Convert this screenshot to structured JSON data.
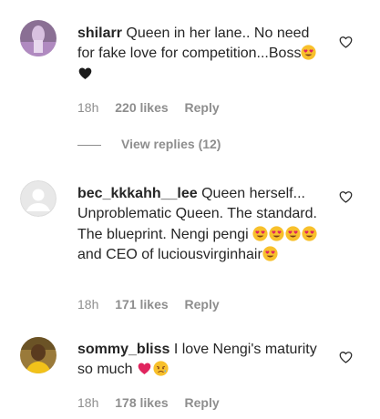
{
  "comments": [
    {
      "username": "shilarr",
      "text": "Queen in her lane.. No need for fake love for competition...Boss",
      "emoji_after": [
        "heart-eyes",
        "black-heart"
      ],
      "time": "18h",
      "likes": "220 likes",
      "reply_label": "Reply",
      "view_replies": "View replies (12)"
    },
    {
      "username": "bec_kkkahh__lee",
      "text_part1": "Queen herself... Unproblematic Queen. The standard. The blueprint. Nengi pengi",
      "emoji_mid": [
        "heart-eyes",
        "heart-eyes",
        "heart-eyes",
        "heart-eyes"
      ],
      "text_part2": "and CEO of luciousvirginhair",
      "emoji_after": [
        "heart-eyes"
      ],
      "time": "18h",
      "likes": "171 likes",
      "reply_label": "Reply"
    },
    {
      "username": "sommy_bliss",
      "text": "I love Nengi's maturity so much",
      "emoji_after": [
        "red-heart",
        "disappointed-relieved"
      ],
      "time": "18h",
      "likes": "178 likes",
      "reply_label": "Reply"
    }
  ],
  "colors": {
    "text": "#262626",
    "meta": "#8e8e8e",
    "emoji_yellow": "#f8c02b",
    "heart_red": "#e0245e"
  }
}
